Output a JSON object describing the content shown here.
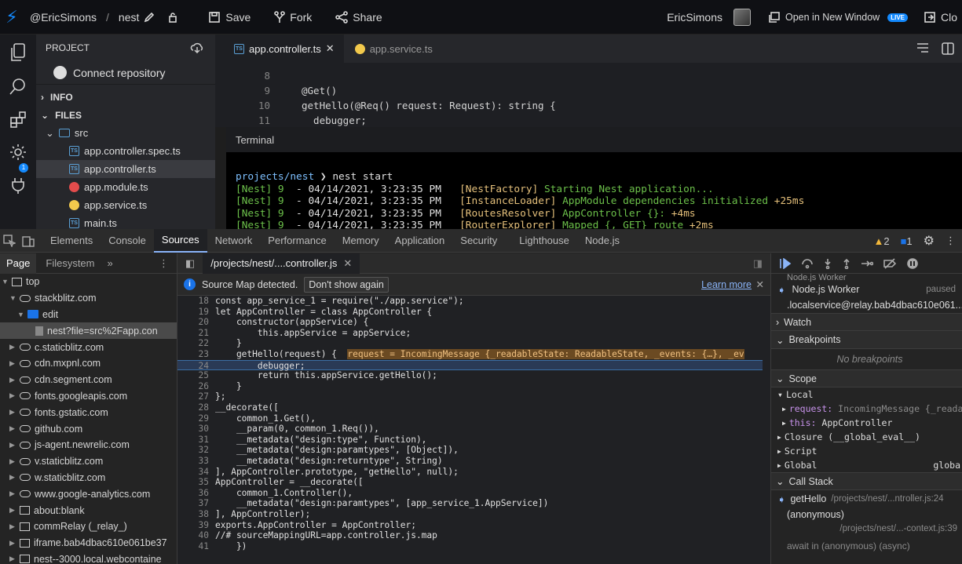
{
  "topbar": {
    "user": "@EricSimons",
    "separator": "/",
    "project": "nest",
    "save": "Save",
    "fork": "Fork",
    "share": "Share",
    "account": "EricSimons",
    "open_new_window": "Open in New Window",
    "live": "LIVE",
    "close": "Clo"
  },
  "project_panel": {
    "title": "PROJECT",
    "connect": "Connect repository",
    "info": "INFO",
    "files": "FILES",
    "folder": "src",
    "files_list": [
      "app.controller.spec.ts",
      "app.controller.ts",
      "app.module.ts",
      "app.service.ts",
      "main.ts"
    ],
    "badge": "1"
  },
  "editor": {
    "tabs": [
      {
        "label": "app.controller.ts",
        "icon": "TS"
      },
      {
        "label": "app.service.ts",
        "icon": "angular-icon"
      }
    ],
    "lines": [
      {
        "n": "8",
        "t": ""
      },
      {
        "n": "9",
        "t": "@Get()"
      },
      {
        "n": "10",
        "t": "getHello(@Req() request: Request): string {"
      },
      {
        "n": "11",
        "t": "  debugger;"
      }
    ]
  },
  "terminal": {
    "title": "Terminal",
    "prompt_path": "projects/nest",
    "prompt_arrow": "❯",
    "command": "nest start",
    "logs": [
      {
        "pfx": "[Nest] 9",
        "ts": "  - 04/14/2021, 3:23:35 PM",
        "ctx": "[NestFactory]",
        "msg": "Starting Nest application...",
        "ms": ""
      },
      {
        "pfx": "[Nest] 9",
        "ts": "  - 04/14/2021, 3:23:35 PM",
        "ctx": "[InstanceLoader]",
        "msg": "AppModule dependencies initialized",
        "ms": "+25ms"
      },
      {
        "pfx": "[Nest] 9",
        "ts": "  - 04/14/2021, 3:23:35 PM",
        "ctx": "[RoutesResolver]",
        "msg": "AppController {}:",
        "ms": "+4ms"
      },
      {
        "pfx": "[Nest] 9",
        "ts": "  - 04/14/2021, 3:23:35 PM",
        "ctx": "[RouterExplorer]",
        "msg": "Mapped {, GET} route",
        "ms": "+2ms"
      }
    ]
  },
  "devtools": {
    "tabs": [
      "Elements",
      "Console",
      "Sources",
      "Network",
      "Performance",
      "Memory",
      "Application",
      "Security",
      "Lighthouse",
      "Node.js"
    ],
    "active_tab": "Sources",
    "warnings": "2",
    "infos": "1",
    "nav_tabs": [
      "Page",
      "Filesystem",
      "»"
    ],
    "nav_items": [
      {
        "label": "top",
        "kind": "frame",
        "indent": 0
      },
      {
        "label": "stackblitz.com",
        "kind": "cloud",
        "indent": 1
      },
      {
        "label": "edit",
        "kind": "folder",
        "indent": 2
      },
      {
        "label": "nest?file=src%2Fapp.con",
        "kind": "file",
        "indent": 3
      },
      {
        "label": "c.staticblitz.com",
        "kind": "cloud",
        "indent": 1
      },
      {
        "label": "cdn.mxpnl.com",
        "kind": "cloud",
        "indent": 1
      },
      {
        "label": "cdn.segment.com",
        "kind": "cloud",
        "indent": 1
      },
      {
        "label": "fonts.googleapis.com",
        "kind": "cloud",
        "indent": 1
      },
      {
        "label": "fonts.gstatic.com",
        "kind": "cloud",
        "indent": 1
      },
      {
        "label": "github.com",
        "kind": "cloud",
        "indent": 1
      },
      {
        "label": "js-agent.newrelic.com",
        "kind": "cloud",
        "indent": 1
      },
      {
        "label": "v.staticblitz.com",
        "kind": "cloud",
        "indent": 1
      },
      {
        "label": "w.staticblitz.com",
        "kind": "cloud",
        "indent": 1
      },
      {
        "label": "www.google-analytics.com",
        "kind": "cloud",
        "indent": 1
      },
      {
        "label": "about:blank",
        "kind": "frame",
        "indent": 1
      },
      {
        "label": "commRelay (_relay_)",
        "kind": "frame",
        "indent": 1
      },
      {
        "label": "iframe.bab4dbac610e061be37",
        "kind": "frame",
        "indent": 1
      },
      {
        "label": "nest--3000.local.webcontaine",
        "kind": "frame",
        "indent": 1
      }
    ],
    "file_tab": "/projects/nest/....controller.js",
    "infobar": {
      "text": "Source Map detected.",
      "button": "Don't show again",
      "link": "Learn more"
    },
    "code": [
      {
        "n": "18",
        "t": "const app_service_1 = require(\"./app.service\");"
      },
      {
        "n": "19",
        "t": "let AppController = class AppController {"
      },
      {
        "n": "20",
        "t": "    constructor(appService) {"
      },
      {
        "n": "21",
        "t": "        this.appService = appService;"
      },
      {
        "n": "22",
        "t": "    }"
      },
      {
        "n": "23",
        "t": "    getHello(request) {",
        "inline": "request = IncomingMessage {_readableState: ReadableState, _events: {…}, _ev"
      },
      {
        "n": "24",
        "t": "        debugger;",
        "hl": true
      },
      {
        "n": "25",
        "t": "        return this.appService.getHello();"
      },
      {
        "n": "26",
        "t": "    }"
      },
      {
        "n": "27",
        "t": "};"
      },
      {
        "n": "28",
        "t": "__decorate(["
      },
      {
        "n": "29",
        "t": "    common_1.Get(),"
      },
      {
        "n": "30",
        "t": "    __param(0, common_1.Req()),"
      },
      {
        "n": "31",
        "t": "    __metadata(\"design:type\", Function),"
      },
      {
        "n": "32",
        "t": "    __metadata(\"design:paramtypes\", [Object]),"
      },
      {
        "n": "33",
        "t": "    __metadata(\"design:returntype\", String)"
      },
      {
        "n": "34",
        "t": "], AppController.prototype, \"getHello\", null);"
      },
      {
        "n": "35",
        "t": "AppController = __decorate(["
      },
      {
        "n": "36",
        "t": "    common_1.Controller(),"
      },
      {
        "n": "37",
        "t": "    __metadata(\"design:paramtypes\", [app_service_1.AppService])"
      },
      {
        "n": "38",
        "t": "], AppController);"
      },
      {
        "n": "39",
        "t": "exports.AppController = AppController;"
      },
      {
        "n": "40",
        "t": "//# sourceMappingURL=app.controller.js.map"
      },
      {
        "n": "41",
        "t": "    })"
      }
    ],
    "debugger": {
      "threads_partial": "Node.js Worker",
      "thread": "Node.js Worker",
      "thread_state": "paused",
      "thread_url": ".localservice@relay.bab4dbac610e061...",
      "watch": "Watch",
      "breakpoints": "Breakpoints",
      "no_breakpoints": "No breakpoints",
      "scope": "Scope",
      "local": "Local",
      "request_key": "request:",
      "request_val": "IncomingMessage {_reada",
      "this_key": "this:",
      "this_val": "AppController",
      "closure": "Closure (__global_eval__)",
      "script": "Script",
      "global": "Global",
      "global_val": "globa",
      "call_stack": "Call Stack",
      "frames": [
        {
          "fn": "getHello",
          "loc": "/projects/nest/...ntroller.js:24"
        },
        {
          "fn": "(anonymous)",
          "loc": "/projects/nest/...-context.js:39"
        }
      ],
      "await": "await in (anonymous) (async)"
    }
  }
}
